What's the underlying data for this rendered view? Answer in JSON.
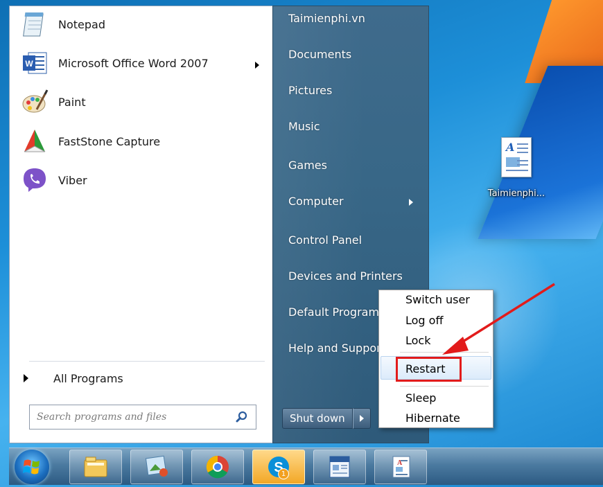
{
  "programs": [
    {
      "label": "Notepad",
      "icon": "notepad-icon"
    },
    {
      "label": "Microsoft Office Word 2007",
      "icon": "word-icon",
      "has_submenu": true
    },
    {
      "label": "Paint",
      "icon": "paint-icon"
    },
    {
      "label": "FastStone Capture",
      "icon": "faststone-icon"
    },
    {
      "label": "Viber",
      "icon": "viber-icon"
    }
  ],
  "all_programs": "All Programs",
  "search": {
    "placeholder": "Search programs and files"
  },
  "right_menu": [
    {
      "label": "Taimienphi.vn"
    },
    {
      "label": "Documents"
    },
    {
      "label": "Pictures"
    },
    {
      "label": "Music"
    },
    {
      "label": "Games"
    },
    {
      "label": "Computer",
      "has_submenu": true
    },
    {
      "label": "Control Panel"
    },
    {
      "label": "Devices and Printers"
    },
    {
      "label": "Default Programs"
    },
    {
      "label": "Help and Support"
    }
  ],
  "shutdown": {
    "label": "Shut down"
  },
  "power_menu": {
    "items": [
      "Switch user",
      "Log off",
      "Lock",
      "Restart",
      "Sleep",
      "Hibernate"
    ],
    "highlighted": "Restart"
  },
  "desktop_icon": {
    "label": "Taimienphi..."
  },
  "taskbar": {
    "buttons": [
      "explorer-icon",
      "photo-viewer-icon",
      "chrome-icon",
      "skype-icon",
      "news-icon",
      "document-icon"
    ],
    "skype_badge": "1"
  },
  "colors": {
    "highlight_box": "#e21b1b",
    "annotation_arrow": "#e21b1b"
  }
}
